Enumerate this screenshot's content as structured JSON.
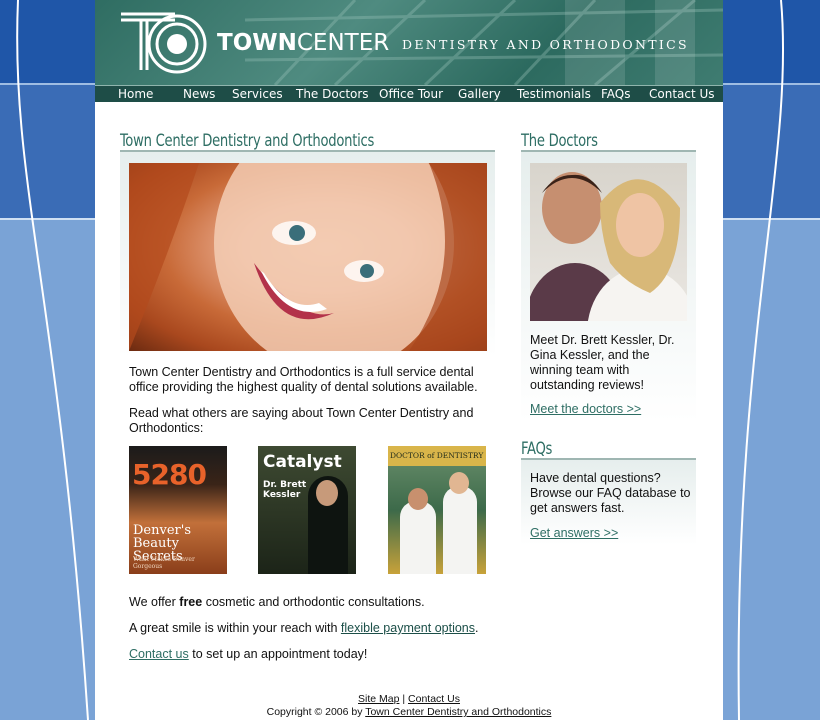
{
  "header": {
    "logo_town": "TOWN",
    "logo_center": "CENTER",
    "logo_tagline": "DENTISTRY AND ORTHODONTICS"
  },
  "nav": {
    "items": [
      "Home",
      "News",
      "Services",
      "The Doctors",
      "Office Tour",
      "Gallery",
      "Testimonials",
      "FAQs",
      "Contact Us"
    ]
  },
  "main": {
    "title": "Town Center Dentistry and Orthodontics",
    "intro": "Town Center Dentistry and Orthodontics is a full service dental office providing the highest quality of dental solutions available.",
    "read_more": "Read what others are saying about Town Center Dentistry and Orthodontics:",
    "magazines": [
      {
        "title": "5280",
        "subtitle": "Denver's Beauty Secrets",
        "sub2": "What Makes Denver Gorgeous"
      },
      {
        "title": "Catalyst",
        "subtitle": "Dr. Brett Kessler"
      },
      {
        "title": "DOCTOR of DENTISTRY"
      }
    ],
    "free_text_1": "We offer",
    "free_word": "free",
    "free_text_2": "cosmetic and orthodontic consultations.",
    "smile_text": "A great smile is within your reach with",
    "payment_link": "flexible payment options",
    "period": ".",
    "contact_link": "Contact us",
    "contact_text": "to set up an appointment today!"
  },
  "sidebar": {
    "doctors_title": "The Doctors",
    "doctors_text": "Meet Dr. Brett Kessler, Dr. Gina Kessler, and the winning team with outstanding reviews!",
    "doctors_link": "Meet the doctors >>",
    "faqs_title": "FAQs",
    "faqs_text": "Have dental questions? Browse our FAQ database to get answers fast.",
    "faqs_link": "Get answers >>"
  },
  "footer": {
    "sitemap": "Site Map",
    "separator": "|",
    "contact": "Contact Us",
    "copyright": "Copyright © 2006 by",
    "company_link": "Town Center Dentistry and Orthodontics"
  },
  "colors": {
    "teal": "#2e6e64",
    "nav_bg": "#1e4d47",
    "side_blue": "#1f56a8"
  }
}
